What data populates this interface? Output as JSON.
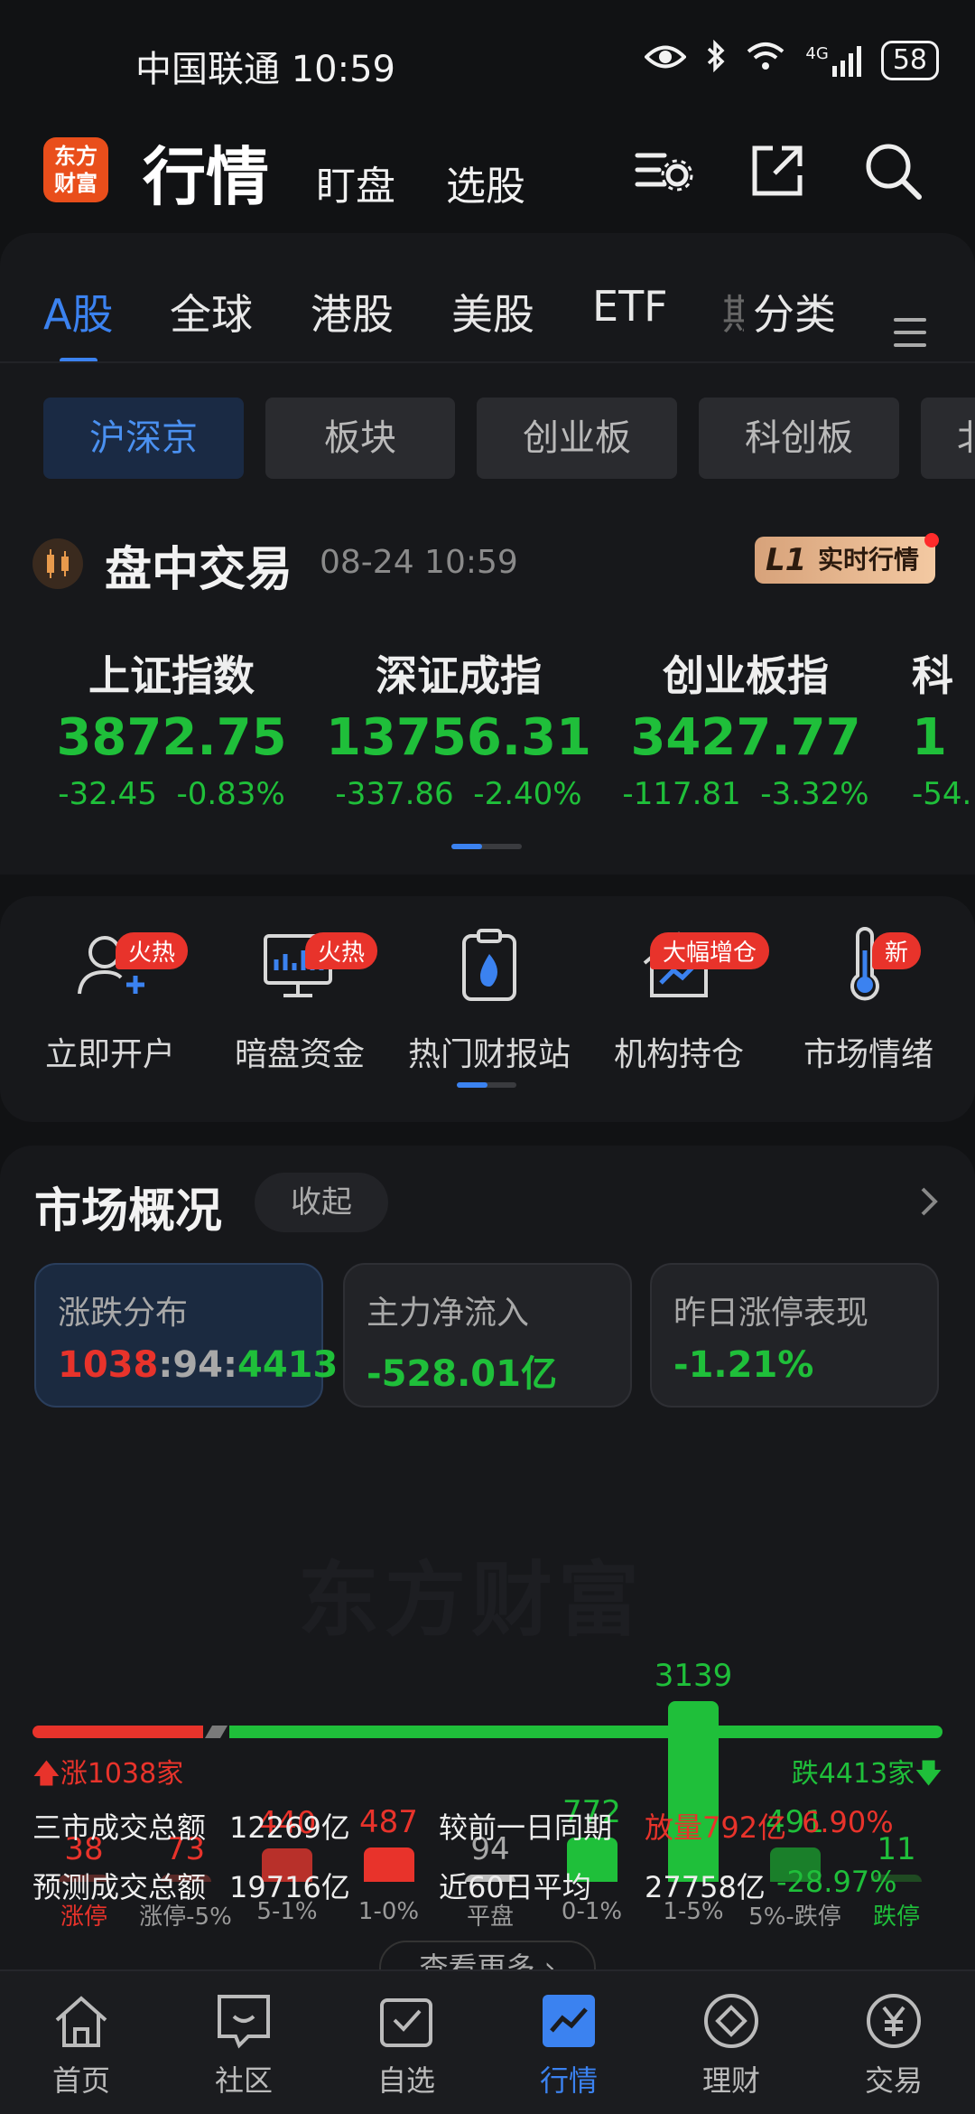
{
  "status_bar": {
    "carrier_time": "中国联通 10:59",
    "network": "4G",
    "battery": "58"
  },
  "header": {
    "logo_text": "东方\n财富",
    "title": "行情",
    "sub1": "盯盘",
    "sub2": "选股"
  },
  "market_tabs": [
    {
      "label": "A股"
    },
    {
      "label": "全球"
    },
    {
      "label": "港股"
    },
    {
      "label": "美股"
    },
    {
      "label": "ETF"
    },
    {
      "label": "期"
    },
    {
      "label": "分类"
    }
  ],
  "sub_tabs": [
    {
      "label": "沪深京"
    },
    {
      "label": "板块"
    },
    {
      "label": "创业板"
    },
    {
      "label": "科创板"
    },
    {
      "label": "北"
    }
  ],
  "trading": {
    "title": "盘中交易",
    "time": "08-24 10:59",
    "badge_l1": "L1",
    "badge_text": "实时行情"
  },
  "indices": [
    {
      "name": "上证指数",
      "value": "3872.75",
      "change": "-32.45",
      "pct": "-0.83%"
    },
    {
      "name": "深证成指",
      "value": "13756.31",
      "change": "-337.86",
      "pct": "-2.40%"
    },
    {
      "name": "创业板指",
      "value": "3427.77",
      "change": "-117.81",
      "pct": "-3.32%"
    },
    {
      "name": "科",
      "value": "1",
      "change": "-54.",
      "pct": ""
    }
  ],
  "quick_entries": [
    {
      "label": "立即开户",
      "badge": "火热"
    },
    {
      "label": "暗盘资金",
      "badge": "火热"
    },
    {
      "label": "热门财报站",
      "badge": ""
    },
    {
      "label": "机构持仓",
      "badge": "大幅增仓"
    },
    {
      "label": "市场情绪",
      "badge": "新"
    }
  ],
  "overview": {
    "title": "市场概况",
    "collapse": "收起",
    "cards": [
      {
        "label": "涨跌分布",
        "rise": "1038",
        "flat": "94",
        "fall": "4413",
        "sep": ":"
      },
      {
        "label": "主力净流入",
        "value": "-528.01亿"
      },
      {
        "label": "昨日涨停表现",
        "value": "-1.21%"
      }
    ],
    "watermark": "东方财富",
    "rise_count": "涨1038家",
    "fall_count": "跌4413家",
    "turnover": {
      "total_label": "三市成交总额",
      "total_value": "12269亿",
      "compare_label": "较前一日同期",
      "compare_value": "放量792亿",
      "compare_pct": "6.90%",
      "forecast_label": "预测成交总额",
      "forecast_value": "19716亿",
      "avg_label": "近60日平均",
      "avg_value": "27758亿",
      "avg_pct": "-28.97%"
    },
    "more": "查看更多 ›"
  },
  "chart_data": {
    "type": "bar",
    "categories": [
      "涨停",
      "涨停-5%",
      "5-1%",
      "1-0%",
      "平盘",
      "0-1%",
      "1-5%",
      "5%-跌停",
      "跌停"
    ],
    "values": [
      38,
      73,
      440,
      487,
      94,
      772,
      3139,
      491,
      11
    ],
    "colors": [
      "#e8332b",
      "#e8332b",
      "#e8332b",
      "#e8332b",
      "#a8a8a8",
      "#1fbf3a",
      "#1fbf3a",
      "#1fbf3a",
      "#1fbf3a"
    ]
  },
  "bottom_nav": [
    {
      "label": "首页"
    },
    {
      "label": "社区"
    },
    {
      "label": "自选"
    },
    {
      "label": "行情"
    },
    {
      "label": "理财"
    },
    {
      "label": "交易"
    }
  ]
}
